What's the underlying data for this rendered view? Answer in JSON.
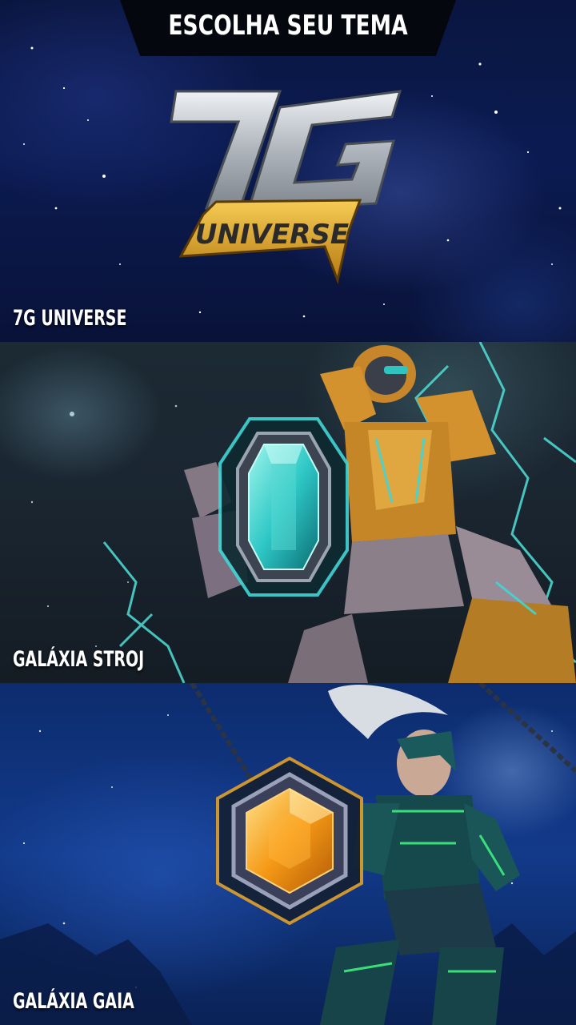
{
  "header": {
    "title": "ESCOLHA SEU TEMA"
  },
  "themes": [
    {
      "label": "7G UNIVERSE",
      "logo_text": "7G",
      "logo_subtext": "UNIVERSE"
    },
    {
      "label": "GALÁXIA STROJ",
      "gem_color": "#3fd6d4"
    },
    {
      "label": "GALÁXIA GAIA",
      "gem_color": "#f5a020"
    }
  ],
  "colors": {
    "header_bg": "#05070f",
    "label_text": "#ffffff",
    "logo_silver": "#cfd3d8",
    "logo_gold": "#e2a82b",
    "stroj_accent": "#3fd6d4",
    "gaia_accent": "#f5a020"
  }
}
